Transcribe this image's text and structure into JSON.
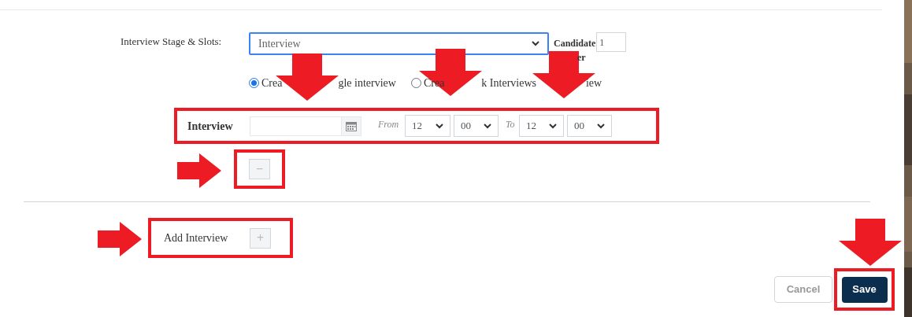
{
  "stage_slots": {
    "label": "Interview Stage & Slots:",
    "value": "Interview",
    "focused": true
  },
  "candidate": {
    "label": "Candidate",
    "value": "1",
    "label_rest": "er"
  },
  "radio_options": [
    {
      "parts": [
        "Crea",
        "gle interview"
      ],
      "selected": true
    },
    {
      "parts": [
        "Crea",
        "k Interviews"
      ],
      "selected": false
    }
  ],
  "covered_option_text": "iew",
  "interview_row": {
    "label": "Interview",
    "from_label": "From",
    "from_hour": "12",
    "from_minute": "00",
    "to_label": "To",
    "to_hour": "12",
    "to_minute": "00"
  },
  "remove_button": {
    "symbol": "−"
  },
  "add_interview": {
    "label": "Add Interview",
    "symbol": "+"
  },
  "buttons": [
    {
      "label": "Cancel",
      "kind": "secondary"
    },
    {
      "label": "Save",
      "kind": "primary"
    }
  ],
  "annotations": [
    {
      "kind": "down_arrow"
    },
    {
      "kind": "down_arrow"
    },
    {
      "kind": "down_arrow"
    },
    {
      "kind": "right_arrow"
    },
    {
      "kind": "right_arrow"
    },
    {
      "kind": "down_arrow"
    }
  ]
}
